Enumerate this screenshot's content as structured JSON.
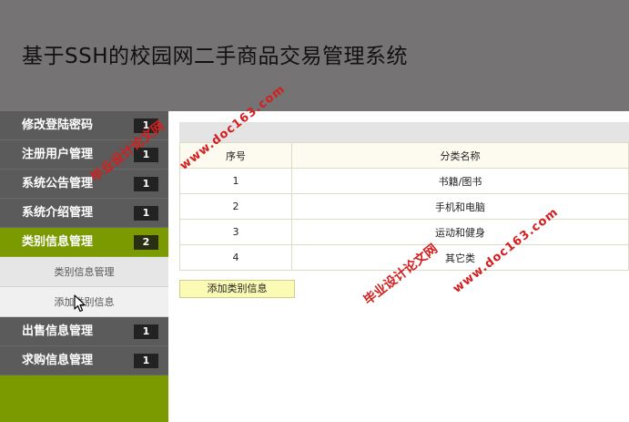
{
  "header": {
    "title": "基于SSH的校园网二手商品交易管理系统"
  },
  "sidebar": {
    "items": [
      {
        "label": "修改登陆密码",
        "badge": "1"
      },
      {
        "label": "注册用户管理",
        "badge": "1"
      },
      {
        "label": "系统公告管理",
        "badge": "1"
      },
      {
        "label": "系统介绍管理",
        "badge": "1"
      },
      {
        "label": "类别信息管理",
        "badge": "2"
      },
      {
        "label": "出售信息管理",
        "badge": "1"
      },
      {
        "label": "求购信息管理",
        "badge": "1"
      }
    ],
    "subitems": [
      {
        "label": "类别信息管理"
      },
      {
        "label": "添加类别信息"
      }
    ]
  },
  "table": {
    "headers": [
      "序号",
      "分类名称"
    ],
    "rows": [
      [
        "1",
        "书籍/图书"
      ],
      [
        "2",
        "手机和电脑"
      ],
      [
        "3",
        "运动和健身"
      ],
      [
        "4",
        "其它类"
      ]
    ]
  },
  "add_button": {
    "label": "添加类别信息"
  },
  "watermark": {
    "line1": "毕业设计论文网",
    "line2": "www.doc163.com",
    "color": "#d41f1f"
  }
}
